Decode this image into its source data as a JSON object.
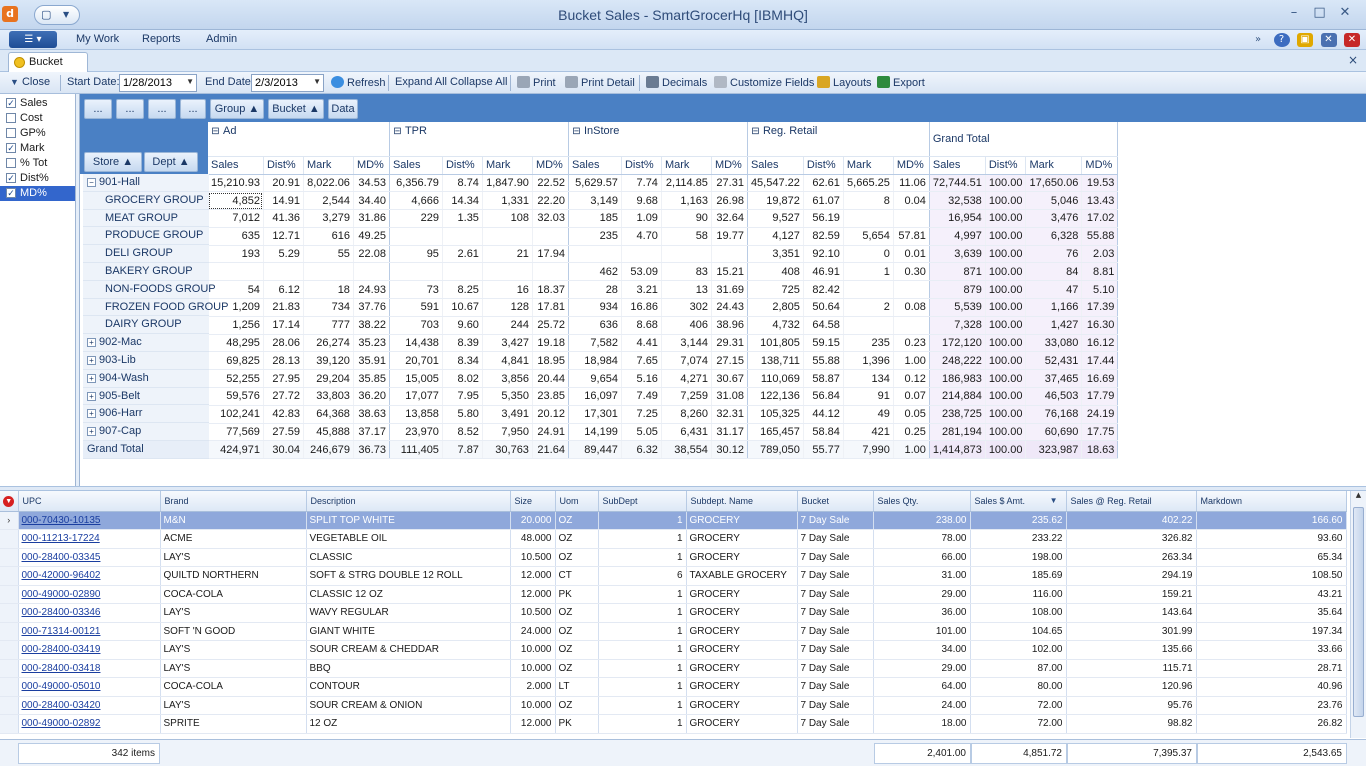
{
  "window": {
    "title": "Bucket Sales - SmartGrocerHq [IBMHQ]",
    "app_icon": "d",
    "minimize": "–",
    "maximize": "□",
    "close": "✕"
  },
  "menu": {
    "items": [
      "My Work",
      "Reports",
      "Admin"
    ]
  },
  "tabs": {
    "active": "Bucket Sales",
    "close": "×"
  },
  "toolbar": {
    "close": "Close",
    "start_date_label": "Start Date:",
    "start_date": "1/28/2013",
    "end_date_label": "End Date",
    "end_date": "2/3/2013",
    "refresh": "Refresh",
    "expand_all": "Expand All",
    "collapse_all": "Collapse All",
    "print": "Print",
    "print_detail": "Print Detail",
    "decimals": "Decimals",
    "customize_fields": "Customize Fields",
    "layouts": "Layouts",
    "export": "Export"
  },
  "fields": [
    {
      "label": "Sales",
      "checked": true
    },
    {
      "label": "Cost",
      "checked": false
    },
    {
      "label": "GP%",
      "checked": false
    },
    {
      "label": "Mark",
      "checked": true
    },
    {
      "label": "% Tot",
      "checked": false
    },
    {
      "label": "Dist%",
      "checked": true
    },
    {
      "label": "MD%",
      "checked": true,
      "selected": true
    }
  ],
  "pivot": {
    "filter_buttons": [
      "...",
      "...",
      "...",
      "..."
    ],
    "column_fields": [
      "Group ▲",
      "Bucket ▲",
      "Data"
    ],
    "row_fields": [
      "Store ▲",
      "Dept ▲"
    ],
    "buckets": [
      "Ad",
      "TPR",
      "InStore",
      "Reg. Retail",
      "Grand Total"
    ],
    "measures": [
      "Sales",
      "Dist%",
      "Mark",
      "MD%"
    ],
    "rows": [
      {
        "label": "901-Hall",
        "level": 0,
        "expanded": true,
        "cells": [
          "15,210.93",
          "20.91",
          "8,022.06",
          "34.53",
          "6,356.79",
          "8.74",
          "1,847.90",
          "22.52",
          "5,629.57",
          "7.74",
          "2,114.85",
          "27.31",
          "45,547.22",
          "62.61",
          "5,665.25",
          "11.06",
          "72,744.51",
          "100.00",
          "17,650.06",
          "19.53"
        ]
      },
      {
        "label": "GROCERY GROUP",
        "level": 1,
        "cells": [
          "4,852",
          "14.91",
          "2,544",
          "34.40",
          "4,666",
          "14.34",
          "1,331",
          "22.20",
          "3,149",
          "9.68",
          "1,163",
          "26.98",
          "19,872",
          "61.07",
          "8",
          "0.04",
          "32,538",
          "100.00",
          "5,046",
          "13.43"
        ]
      },
      {
        "label": "MEAT GROUP",
        "level": 1,
        "cells": [
          "7,012",
          "41.36",
          "3,279",
          "31.86",
          "229",
          "1.35",
          "108",
          "32.03",
          "185",
          "1.09",
          "90",
          "32.64",
          "9,527",
          "56.19",
          "",
          "",
          "16,954",
          "100.00",
          "3,476",
          "17.02"
        ]
      },
      {
        "label": "PRODUCE GROUP",
        "level": 1,
        "cells": [
          "635",
          "12.71",
          "616",
          "49.25",
          "",
          "",
          "",
          "",
          "235",
          "4.70",
          "58",
          "19.77",
          "4,127",
          "82.59",
          "5,654",
          "57.81",
          "4,997",
          "100.00",
          "6,328",
          "55.88"
        ]
      },
      {
        "label": "DELI GROUP",
        "level": 1,
        "cells": [
          "193",
          "5.29",
          "55",
          "22.08",
          "95",
          "2.61",
          "21",
          "17.94",
          "",
          "",
          "",
          "",
          "3,351",
          "92.10",
          "0",
          "0.01",
          "3,639",
          "100.00",
          "76",
          "2.03"
        ]
      },
      {
        "label": "BAKERY GROUP",
        "level": 1,
        "cells": [
          "",
          "",
          "",
          "",
          "",
          "",
          "",
          "",
          "462",
          "53.09",
          "83",
          "15.21",
          "408",
          "46.91",
          "1",
          "0.30",
          "871",
          "100.00",
          "84",
          "8.81"
        ]
      },
      {
        "label": "NON-FOODS GROUP",
        "level": 1,
        "cells": [
          "54",
          "6.12",
          "18",
          "24.93",
          "73",
          "8.25",
          "16",
          "18.37",
          "28",
          "3.21",
          "13",
          "31.69",
          "725",
          "82.42",
          "",
          "",
          "879",
          "100.00",
          "47",
          "5.10"
        ]
      },
      {
        "label": "FROZEN FOOD GROUP",
        "level": 1,
        "cells": [
          "1,209",
          "21.83",
          "734",
          "37.76",
          "591",
          "10.67",
          "128",
          "17.81",
          "934",
          "16.86",
          "302",
          "24.43",
          "2,805",
          "50.64",
          "2",
          "0.08",
          "5,539",
          "100.00",
          "1,166",
          "17.39"
        ]
      },
      {
        "label": "DAIRY GROUP",
        "level": 1,
        "cells": [
          "1,256",
          "17.14",
          "777",
          "38.22",
          "703",
          "9.60",
          "244",
          "25.72",
          "636",
          "8.68",
          "406",
          "38.96",
          "4,732",
          "64.58",
          "",
          "",
          "7,328",
          "100.00",
          "1,427",
          "16.30"
        ]
      },
      {
        "label": "902-Mac",
        "level": 0,
        "cells": [
          "48,295",
          "28.06",
          "26,274",
          "35.23",
          "14,438",
          "8.39",
          "3,427",
          "19.18",
          "7,582",
          "4.41",
          "3,144",
          "29.31",
          "101,805",
          "59.15",
          "235",
          "0.23",
          "172,120",
          "100.00",
          "33,080",
          "16.12"
        ]
      },
      {
        "label": "903-Lib",
        "level": 0,
        "cells": [
          "69,825",
          "28.13",
          "39,120",
          "35.91",
          "20,701",
          "8.34",
          "4,841",
          "18.95",
          "18,984",
          "7.65",
          "7,074",
          "27.15",
          "138,711",
          "55.88",
          "1,396",
          "1.00",
          "248,222",
          "100.00",
          "52,431",
          "17.44"
        ]
      },
      {
        "label": "904-Wash",
        "level": 0,
        "cells": [
          "52,255",
          "27.95",
          "29,204",
          "35.85",
          "15,005",
          "8.02",
          "3,856",
          "20.44",
          "9,654",
          "5.16",
          "4,271",
          "30.67",
          "110,069",
          "58.87",
          "134",
          "0.12",
          "186,983",
          "100.00",
          "37,465",
          "16.69"
        ]
      },
      {
        "label": "905-Belt",
        "level": 0,
        "cells": [
          "59,576",
          "27.72",
          "33,803",
          "36.20",
          "17,077",
          "7.95",
          "5,350",
          "23.85",
          "16,097",
          "7.49",
          "7,259",
          "31.08",
          "122,136",
          "56.84",
          "91",
          "0.07",
          "214,884",
          "100.00",
          "46,503",
          "17.79"
        ]
      },
      {
        "label": "906-Harr",
        "level": 0,
        "cells": [
          "102,241",
          "42.83",
          "64,368",
          "38.63",
          "13,858",
          "5.80",
          "3,491",
          "20.12",
          "17,301",
          "7.25",
          "8,260",
          "32.31",
          "105,325",
          "44.12",
          "49",
          "0.05",
          "238,725",
          "100.00",
          "76,168",
          "24.19"
        ]
      },
      {
        "label": "907-Cap",
        "level": 0,
        "cells": [
          "77,569",
          "27.59",
          "45,888",
          "37.17",
          "23,970",
          "8.52",
          "7,950",
          "24.91",
          "14,199",
          "5.05",
          "6,431",
          "31.17",
          "165,457",
          "58.84",
          "421",
          "0.25",
          "281,194",
          "100.00",
          "60,690",
          "17.75"
        ]
      },
      {
        "label": "Grand Total",
        "level": -1,
        "cells": [
          "424,971",
          "30.04",
          "246,679",
          "36.73",
          "111,405",
          "7.87",
          "30,763",
          "21.64",
          "89,447",
          "6.32",
          "38,554",
          "30.12",
          "789,050",
          "55.77",
          "7,990",
          "1.00",
          "1,414,873",
          "100.00",
          "323,987",
          "18.63"
        ]
      }
    ]
  },
  "grid": {
    "columns": [
      "UPC",
      "Brand",
      "Description",
      "Size",
      "Uom",
      "SubDept",
      "Subdept. Name",
      "Bucket",
      "Sales Qty.",
      "Sales $ Amt.",
      "Sales @ Reg. Retail",
      "Markdown"
    ],
    "sort_indicator": "▼",
    "rows": [
      [
        "000-70430-10135",
        "M&N",
        "SPLIT TOP WHITE",
        "20.000",
        "OZ",
        "1",
        "GROCERY",
        "7 Day Sale",
        "238.00",
        "235.62",
        "402.22",
        "166.60"
      ],
      [
        "000-11213-17224",
        "ACME",
        "VEGETABLE OIL",
        "48.000",
        "OZ",
        "1",
        "GROCERY",
        "7 Day Sale",
        "78.00",
        "233.22",
        "326.82",
        "93.60"
      ],
      [
        "000-28400-03345",
        "LAY'S",
        "CLASSIC",
        "10.500",
        "OZ",
        "1",
        "GROCERY",
        "7 Day Sale",
        "66.00",
        "198.00",
        "263.34",
        "65.34"
      ],
      [
        "000-42000-96402",
        "QUILTD NORTHERN",
        "SOFT & STRG DOUBLE 12 ROLL",
        "12.000",
        "CT",
        "6",
        "TAXABLE GROCERY",
        "7 Day Sale",
        "31.00",
        "185.69",
        "294.19",
        "108.50"
      ],
      [
        "000-49000-02890",
        "COCA-COLA",
        "CLASSIC 12 OZ",
        "12.000",
        "PK",
        "1",
        "GROCERY",
        "7 Day Sale",
        "29.00",
        "116.00",
        "159.21",
        "43.21"
      ],
      [
        "000-28400-03346",
        "LAY'S",
        "WAVY REGULAR",
        "10.500",
        "OZ",
        "1",
        "GROCERY",
        "7 Day Sale",
        "36.00",
        "108.00",
        "143.64",
        "35.64"
      ],
      [
        "000-71314-00121",
        "SOFT 'N GOOD",
        "GIANT WHITE",
        "24.000",
        "OZ",
        "1",
        "GROCERY",
        "7 Day Sale",
        "101.00",
        "104.65",
        "301.99",
        "197.34"
      ],
      [
        "000-28400-03419",
        "LAY'S",
        "SOUR CREAM & CHEDDAR",
        "10.000",
        "OZ",
        "1",
        "GROCERY",
        "7 Day Sale",
        "34.00",
        "102.00",
        "135.66",
        "33.66"
      ],
      [
        "000-28400-03418",
        "LAY'S",
        "BBQ",
        "10.000",
        "OZ",
        "1",
        "GROCERY",
        "7 Day Sale",
        "29.00",
        "87.00",
        "115.71",
        "28.71"
      ],
      [
        "000-49000-05010",
        "COCA-COLA",
        "CONTOUR",
        "2.000",
        "LT",
        "1",
        "GROCERY",
        "7 Day Sale",
        "64.00",
        "80.00",
        "120.96",
        "40.96"
      ],
      [
        "000-28400-03420",
        "LAY'S",
        "SOUR CREAM & ONION",
        "10.000",
        "OZ",
        "1",
        "GROCERY",
        "7 Day Sale",
        "24.00",
        "72.00",
        "95.76",
        "23.76"
      ],
      [
        "000-49000-02892",
        "SPRITE",
        "12 OZ",
        "12.000",
        "PK",
        "1",
        "GROCERY",
        "7 Day Sale",
        "18.00",
        "72.00",
        "98.82",
        "26.82"
      ]
    ],
    "footer": {
      "count": "342 items",
      "sales_qty": "2,401.00",
      "sales_amt": "4,851.72",
      "sales_reg": "7,395.37",
      "markdown": "2,543.65"
    }
  }
}
